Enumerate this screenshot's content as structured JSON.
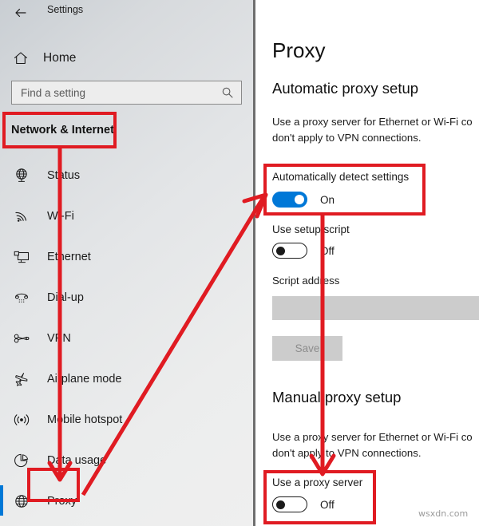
{
  "window": {
    "title": "Settings",
    "back_icon": "back-arrow-icon"
  },
  "sidebar": {
    "home": {
      "label": "Home",
      "icon": "home-icon"
    },
    "search": {
      "placeholder": "Find a setting",
      "value": "",
      "icon": "search-icon"
    },
    "category": {
      "label": "Network & Internet"
    },
    "items": [
      {
        "label": "Status",
        "icon": "globe-status-icon",
        "selected": false
      },
      {
        "label": "Wi-Fi",
        "icon": "wifi-icon",
        "selected": false
      },
      {
        "label": "Ethernet",
        "icon": "ethernet-icon",
        "selected": false
      },
      {
        "label": "Dial-up",
        "icon": "dialup-phone-icon",
        "selected": false
      },
      {
        "label": "VPN",
        "icon": "vpn-key-icon",
        "selected": false
      },
      {
        "label": "Airplane mode",
        "icon": "airplane-icon",
        "selected": false
      },
      {
        "label": "Mobile hotspot",
        "icon": "hotspot-icon",
        "selected": false
      },
      {
        "label": "Data usage",
        "icon": "data-usage-pie-icon",
        "selected": false
      },
      {
        "label": "Proxy",
        "icon": "globe-proxy-icon",
        "selected": true
      }
    ]
  },
  "content": {
    "page_title": "Proxy",
    "automatic": {
      "heading": "Automatic proxy setup",
      "description_line1": "Use a proxy server for Ethernet or Wi-Fi co",
      "description_line2": "don't apply to VPN connections.",
      "auto_detect_label": "Automatically detect settings",
      "auto_detect_state": "On",
      "setup_script_label": "Use setup script",
      "setup_script_state": "Off",
      "script_address_label": "Script address",
      "script_address_value": "",
      "save_label": "Save"
    },
    "manual": {
      "heading": "Manual proxy setup",
      "description_line1": "Use a proxy server for Ethernet or Wi-Fi co",
      "description_line2": "don't apply to VPN connections.",
      "use_proxy_label": "Use a proxy server",
      "use_proxy_state": "Off"
    }
  },
  "watermark": "wsxdn.com",
  "colors": {
    "accent": "#0078d7",
    "annotation": "#e01b22",
    "sidebar_bg": "#e3e5e7",
    "disabled_field": "#cccccc"
  }
}
